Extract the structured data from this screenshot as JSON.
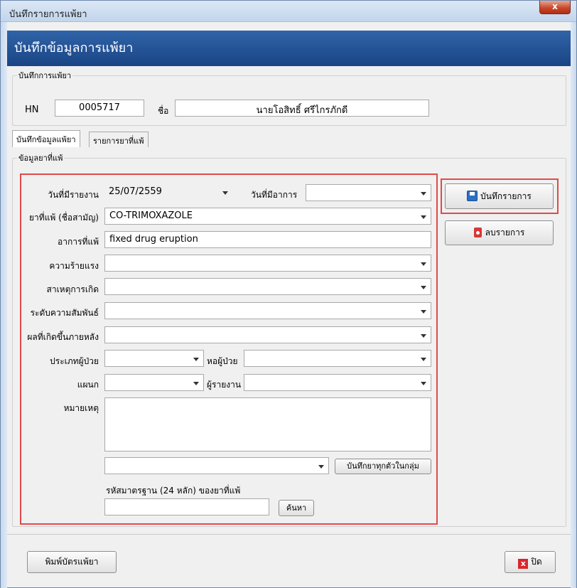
{
  "window": {
    "title": "บันทึกรายการแพ้ยา",
    "close_glyph": "x"
  },
  "header": {
    "title": "บันทึกข้อมูลการแพ้ยา"
  },
  "patient_group": {
    "legend": "บันทึกการแพ้ยา",
    "hn_label": "HN",
    "hn_value": "0005717",
    "name_label": "ชื่อ",
    "name_value": "นายโอสิทธิ์ ศรีไกรภักดี"
  },
  "tabs": [
    {
      "label": "บันทึกข้อมูลแพ้ยา",
      "active": true
    },
    {
      "label": "รายการยาที่แพ้",
      "active": false
    }
  ],
  "drug_group": {
    "legend": "ข้อมูลยาที่แพ้",
    "report_date_label": "วันที่มีรายงาน",
    "report_date_value": "25/07/2559",
    "symptom_date_label": "วันที่มีอาการ",
    "symptom_date_value": "",
    "drug_label": "ยาที่แพ้ (ชื่อสามัญ)",
    "drug_value": "CO-TRIMOXAZOLE",
    "symptom_label": "อาการที่แพ้",
    "symptom_value": "fixed drug eruption",
    "severity_label": "ความร้ายแรง",
    "cause_label": "สาเหตุการเกิด",
    "relation_label": "ระดับความสัมพันธ์",
    "outcome_label": "ผลที่เกิดขึ้นภายหลัง",
    "patient_type_label": "ประเภทผู้ป่วย",
    "ward_label": "หอผู้ป่วย",
    "department_label": "แผนก",
    "reporter_label": "ผู้รายงาน",
    "note_label": "หมายเหตุ",
    "save_group_button": "บันทึกยาทุกตัวในกลุ่ม",
    "code_label": "รหัสมาตรฐาน (24 หลัก) ของยาที่แพ้",
    "search_button": "ค้นหา"
  },
  "actions": {
    "save_button": "บันทึกรายการ",
    "delete_button": "ลบรายการ"
  },
  "footer": {
    "print_button": "พิมพ์บัตรแพ้ยา",
    "close_button": "ปิด",
    "close_icon_glyph": "x"
  },
  "colors": {
    "header_blue": "#1f4d91",
    "highlight_red": "#e04a4a"
  }
}
